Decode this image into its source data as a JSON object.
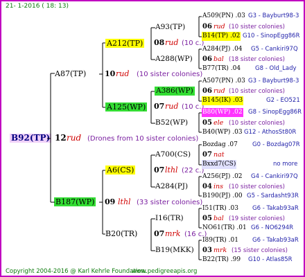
{
  "header": {
    "date": "21-  1-2016 ( 18: 13)"
  },
  "footer": {
    "copyright": "Copyright 2004-2016 @ Karl Kehrle Foundation.",
    "url": "www.pedigreeapis.org"
  },
  "root": {
    "id": "B92(TP)",
    "gen": "12",
    "race": "rud",
    "note": "(Drones from 10 sister colonies)"
  },
  "gen1": [
    {
      "id": "A87(TP)",
      "gen": "10",
      "race": "rud",
      "note": "(10 sister colonies)"
    },
    {
      "id": "B187(WP)",
      "gen": "09",
      "race": "lthl",
      "note": "(33 sister colonies)"
    }
  ],
  "gen2": [
    {
      "id": "A212(TP)",
      "gen": "08",
      "race": "rud",
      "note": "(10 c.)"
    },
    {
      "id": "A125(WP)",
      "gen": "07",
      "race": "rud",
      "note": "(10 c.)"
    },
    {
      "id": "A6(CS)",
      "gen": "07",
      "race": "lthl",
      "note": "(22 c.)"
    },
    {
      "id": "B20(TR)",
      "gen": "07",
      "race": "mrk",
      "note": "(16 c.)"
    }
  ],
  "gen3": [
    {
      "id": "A93(TP)"
    },
    {
      "id": "A288(WP)"
    },
    {
      "id": "A386(WP)"
    },
    {
      "id": "B52(WP)"
    },
    {
      "id": "A700(CS)"
    },
    {
      "id": "A284(PJ)"
    },
    {
      "id": "I16(TR)"
    },
    {
      "id": "B19(MKK)"
    }
  ],
  "leaves": [
    {
      "a": "A509(PN) .03",
      "a2": "G3 - Bayburt98-3",
      "gen": "06",
      "race": "rud",
      "note": "(10 sister colonies)",
      "b": "B14(TP) .02",
      "b2": "G10 - SinopEgg86R"
    },
    {
      "a": "A284(PJ) .04",
      "a2": "G5 - Cankiri97Q",
      "gen": "06",
      "race": "bal",
      "note": "(18 sister colonies)",
      "b": "B77(TR) .04",
      "b2": "G8 - Old_Lady"
    },
    {
      "a": "A507(PN) .03",
      "a2": "G3 - Bayburt98-3",
      "gen": "06",
      "race": "rud",
      "note": "(10 sister colonies)",
      "b": "B145(IK) .03",
      "b2": "G2 - EO521"
    },
    {
      "a": "B80(WP) .02",
      "a2": "G8 - SinopEgg86R",
      "gen": "05",
      "race": "ele",
      "note": "(10 sister colonies)",
      "b": "B40(WP) .03",
      "b2": "G12 - AthosSt80R"
    },
    {
      "a": "Bozdag .07",
      "a2": "G0 - Bozdag07R",
      "gen": "07",
      "race": "nat",
      "note": "",
      "b": "Bxxd7(CS)",
      "b2": "no more"
    },
    {
      "a": "A256(PJ) .02",
      "a2": "G4 - Cankiri97Q",
      "gen": "04",
      "race": "ins",
      "note": "(10 sister colonies)",
      "b": "B190(PJ) .00",
      "b2": "G5 - Sardasht93R"
    },
    {
      "a": "I51(TR) .03",
      "a2": "G6 - Takab93aR",
      "gen": "05",
      "race": "bal",
      "note": "(19 sister colonies)",
      "b": "NO61(TR) .01",
      "b2": "G6 - NO6294R"
    },
    {
      "a": "I89(TR) .01",
      "a2": "G6 - Takab93aR",
      "gen": "03",
      "race": "mrk",
      "note": "(15 sister colonies)",
      "b": "B22(TR) .99",
      "b2": "G10 - Atlas85R"
    }
  ]
}
